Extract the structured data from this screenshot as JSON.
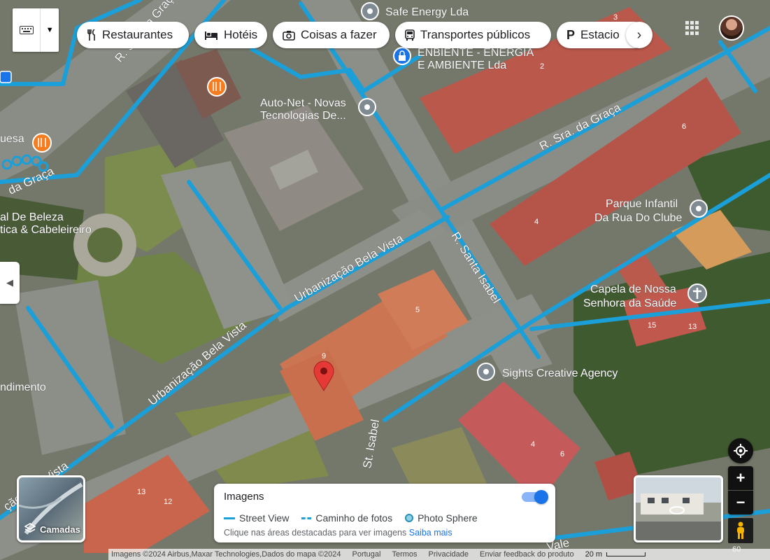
{
  "categories": [
    {
      "label": "Restaurantes",
      "icon": "fork-knife-icon"
    },
    {
      "label": "Hotéis",
      "icon": "bed-icon"
    },
    {
      "label": "Coisas a fazer",
      "icon": "camera-icon"
    },
    {
      "label": "Transportes públicos",
      "icon": "bus-icon"
    },
    {
      "label": "Estacio",
      "icon": "parking-icon"
    }
  ],
  "map_labels": {
    "safe_energy": "Safe Energy Lda",
    "energia_line1": "ENBIENTE - ENERGIA",
    "energia_line2": "E AMBIENTE Lda",
    "autonet_line1": "Auto-Net - Novas",
    "autonet_line2": "Tecnologias De...",
    "parque_line1": "Parque Infantil",
    "parque_line2": "Da Rua Do Clube",
    "capela_line1": "Capela de Nossa",
    "capela_line2": "Senhora da Saúde",
    "sights": "Sights Creative Agency",
    "beleza_line1": "al De Beleza",
    "beleza_line2": "tica & Cabeleireiro",
    "uesa": "uesa",
    "ndimento": "ndimento"
  },
  "street_labels": {
    "sra_graca_top": "R. Sra. da Graça",
    "sra_graca_left": "da Graça",
    "sra_graca_right": "R. Sra. da Graça",
    "santa_isabel": "R. Santa Isabel",
    "urb_bela_vista_1": "Urbanização Bela Vista",
    "urb_bela_vista_2": "Urbanização Bela Vista",
    "urb_bela_vista_3": "ção Bela Vista",
    "st_isabel": "St. Isabel",
    "vale": "Vale"
  },
  "house_numbers": [
    "3",
    "2",
    "6",
    "4",
    "5",
    "9",
    "15",
    "13",
    "4",
    "6",
    "13",
    "12"
  ],
  "layers": {
    "label": "Camadas"
  },
  "imagery_panel": {
    "title": "Imagens",
    "street_view": "Street View",
    "photo_path": "Caminho de fotos",
    "photo_sphere": "Photo Sphere",
    "hint": "Clique nas áreas destacadas para ver imagens",
    "learn_more": "Saiba mais",
    "toggle_on": true
  },
  "controls": {
    "zoom_in": "+",
    "zoom_out": "−",
    "pegman_zoom": "60"
  },
  "footer": {
    "attribution": "Imagens ©2024 Airbus,Maxar Technologies,Dados do mapa ©2024",
    "country": "Portugal",
    "terms": "Termos",
    "privacy": "Privacidade",
    "feedback": "Enviar feedback do produto",
    "scale": "20 m"
  },
  "colors": {
    "route": "#1a9fd9",
    "roof": "#b7554a",
    "pin": "#e53935",
    "poi_orange": "#f57c1f",
    "poi_gray": "#7f8a92"
  }
}
